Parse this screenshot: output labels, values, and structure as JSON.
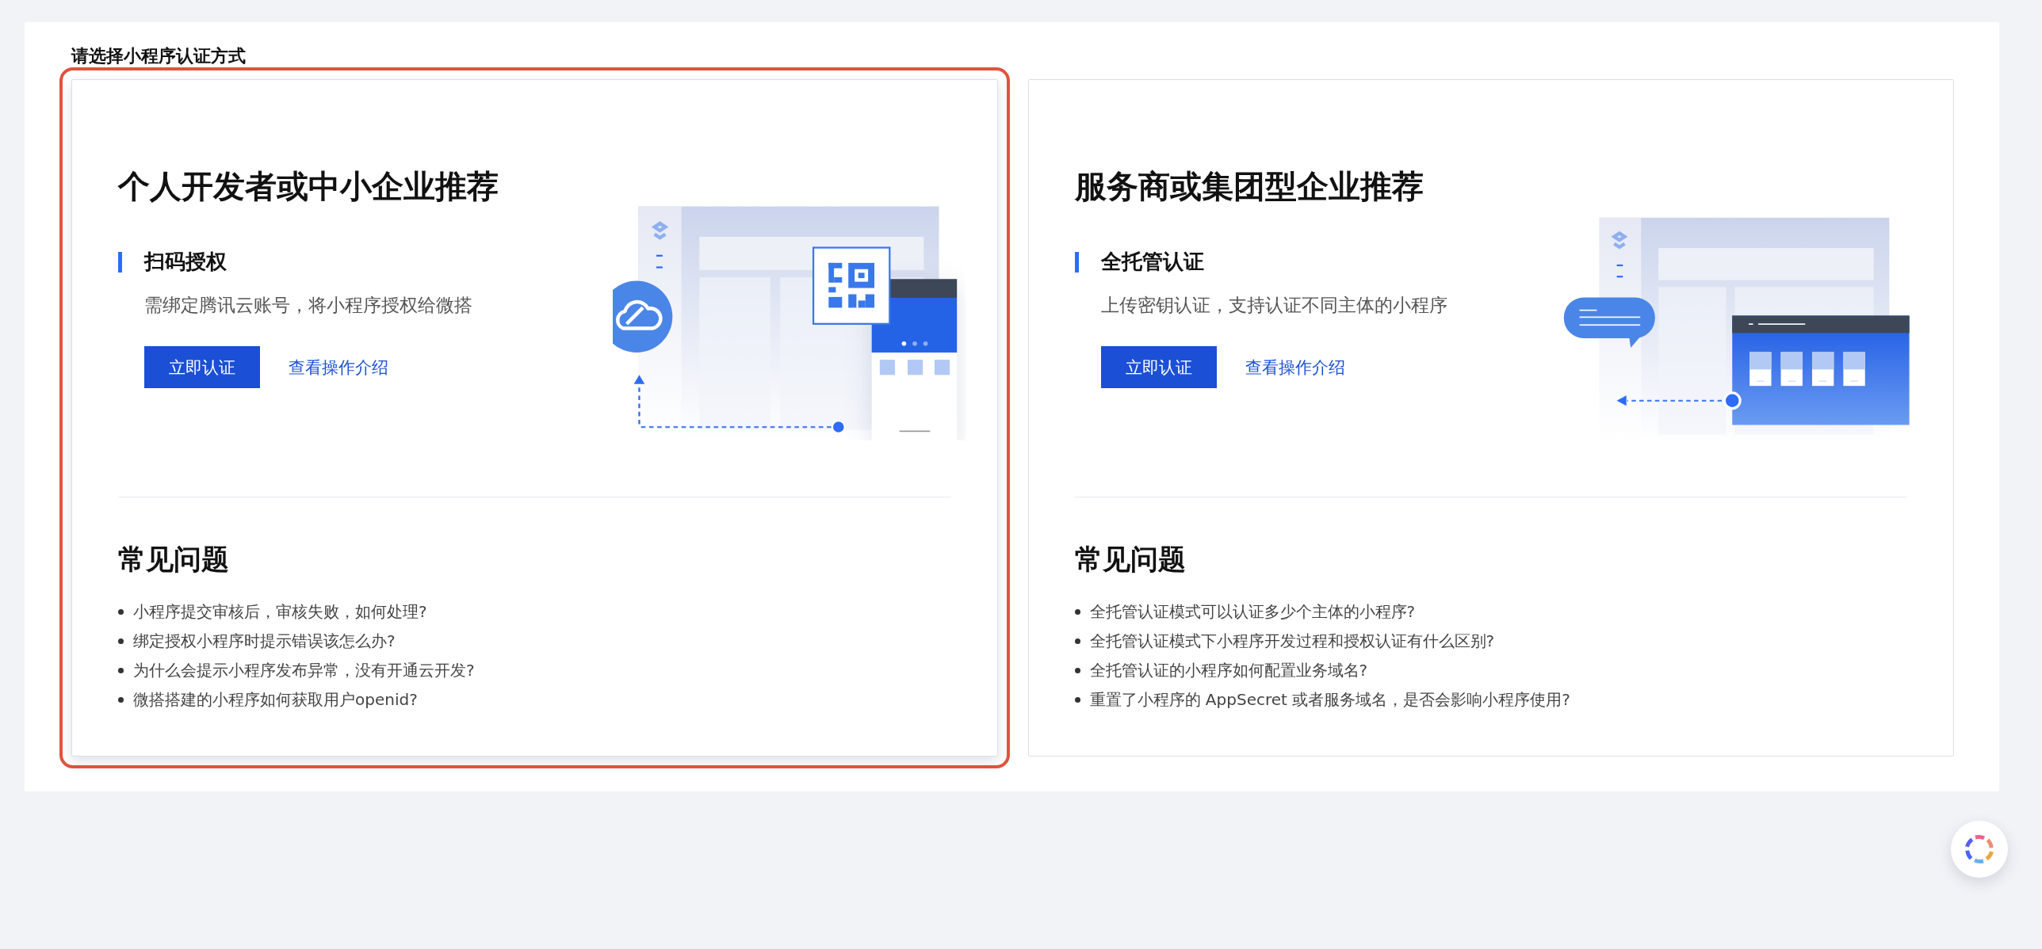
{
  "heading": "请选择小程序认证方式",
  "cards": [
    {
      "selected": true,
      "kind": "qr",
      "title": "个人开发者或中小企业推荐",
      "method": "扫码授权",
      "description": "需绑定腾讯云账号，将小程序授权给微搭",
      "primary_button": "立即认证",
      "link": "查看操作介绍",
      "faq_title": "常见问题",
      "faq": [
        "小程序提交审核后，审核失败，如何处理?",
        "绑定授权小程序时提示错误该怎么办?",
        "为什么会提示小程序发布异常，没有开通云开发?",
        "微搭搭建的小程序如何获取用户openid?"
      ]
    },
    {
      "selected": false,
      "kind": "hosted",
      "title": "服务商或集团型企业推荐",
      "method": "全托管认证",
      "description": "上传密钥认证，支持认证不同主体的小程序",
      "primary_button": "立即认证",
      "link": "查看操作介绍",
      "faq_title": "常见问题",
      "faq": [
        "全托管认证模式可以认证多少个主体的小程序?",
        "全托管认证模式下小程序开发过程和授权认证有什么区别?",
        "全托管认证的小程序如何配置业务域名?",
        "重置了小程序的 AppSecret 或者服务域名，是否会影响小程序使用?"
      ]
    }
  ]
}
